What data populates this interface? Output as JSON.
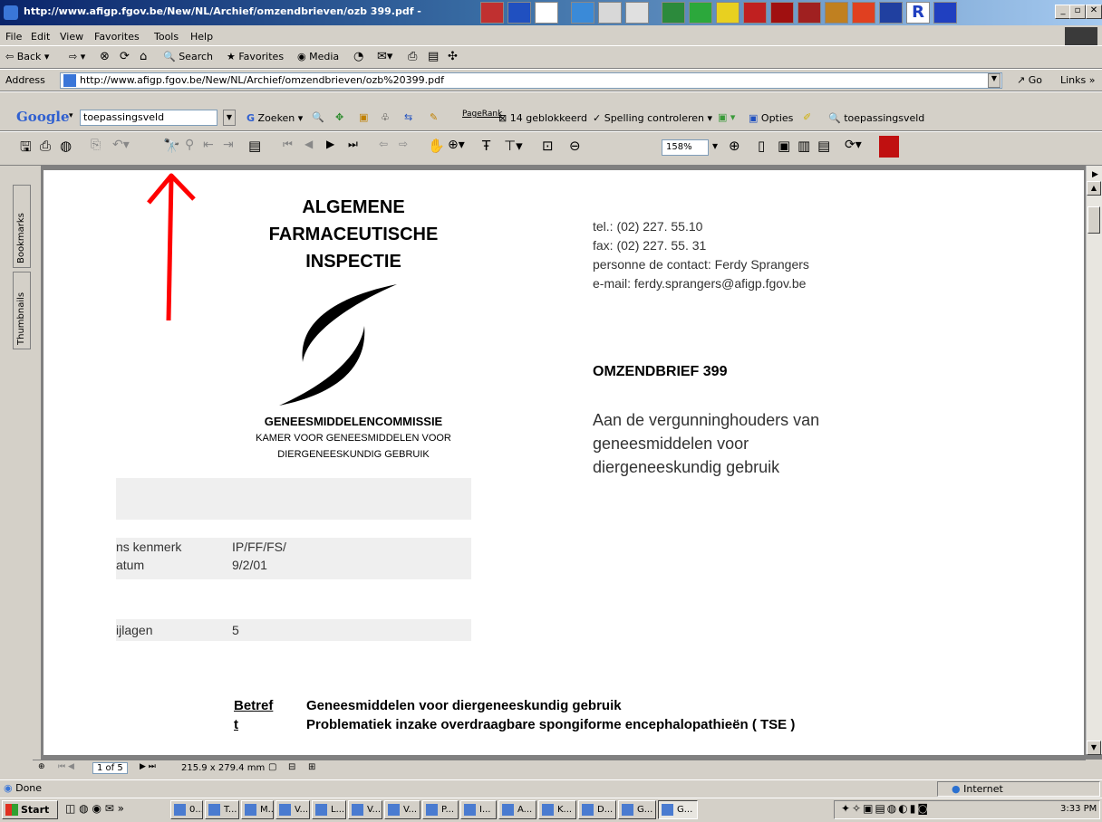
{
  "window": {
    "title": "http://www.afigp.fgov.be/New/NL/Archief/omzendbrieven/ozb 399.pdf -"
  },
  "menu": [
    "File",
    "Edit",
    "View",
    "Favorites",
    "Tools",
    "Help"
  ],
  "toolbar": {
    "back": "Back",
    "search": "Search",
    "favorites": "Favorites",
    "media": "Media"
  },
  "address": {
    "label": "Address",
    "value": "http://www.afigp.fgov.be/New/NL/Archief/omzendbrieven/ozb%20399.pdf",
    "go": "Go",
    "links": "Links »"
  },
  "google": {
    "logo": "Google",
    "query": "toepassingsveld",
    "search_label": "Zoeken",
    "pagerank": "PageRank",
    "blocked": "14 geblokkeerd",
    "spelling": "Spelling controleren",
    "options": "Opties",
    "highlight_term": "toepassingsveld"
  },
  "acrobat": {
    "zoom": "158%"
  },
  "sidebar": {
    "bookmarks": "Bookmarks",
    "thumbnails": "Thumbnails"
  },
  "document": {
    "org_line1": "ALGEMENE",
    "org_line2": "FARMACEUTISCHE",
    "org_line3": "INSPECTIE",
    "commission": "GENEESMIDDELENCOMMISSIE",
    "chamber_line1": "KAMER VOOR GENEESMIDDELEN VOOR",
    "chamber_line2": "DIERGENEESKUNDIG GEBRUIK",
    "tel": "tel.: (02) 227. 55.10",
    "fax": "fax: (02) 227. 55. 31",
    "contact": "personne de contact: Ferdy Sprangers",
    "email": "e-mail: ferdy.sprangers@afigp.fgov.be",
    "circular_title": "OMZENDBRIEF 399",
    "addressee_line1": "Aan de vergunninghouders van",
    "addressee_line2": "geneesmiddelen voor",
    "addressee_line3": "diergeneeskundig gebruik",
    "ref_label": "ns kenmerk",
    "ref_value": "IP/FF/FS/",
    "date_label": "atum",
    "date_value": "9/2/01",
    "attach_label": "ijlagen",
    "attach_value": "5",
    "subject_label_a": "Betref",
    "subject_label_b": "t",
    "subject_line1": "Geneesmiddelen voor diergeneeskundig gebruik",
    "subject_line2": "Problematiek inzake overdraagbare spongiforme encephalopathieën ( TSE )"
  },
  "doc_status": {
    "page": "1 of 5",
    "size": "215.9 x 279.4 mm"
  },
  "status": {
    "text": "Done",
    "zone": "Internet"
  },
  "taskbar": {
    "start": "Start",
    "tasks": [
      "0...",
      "T...",
      "M...",
      "V...",
      "L...",
      "V...",
      "V...",
      "P...",
      "I...",
      "A...",
      "K...",
      "D...",
      "G...",
      "G..."
    ],
    "clock": "3:33 PM"
  },
  "annotation": {
    "arrow_color": "#ff0000"
  }
}
